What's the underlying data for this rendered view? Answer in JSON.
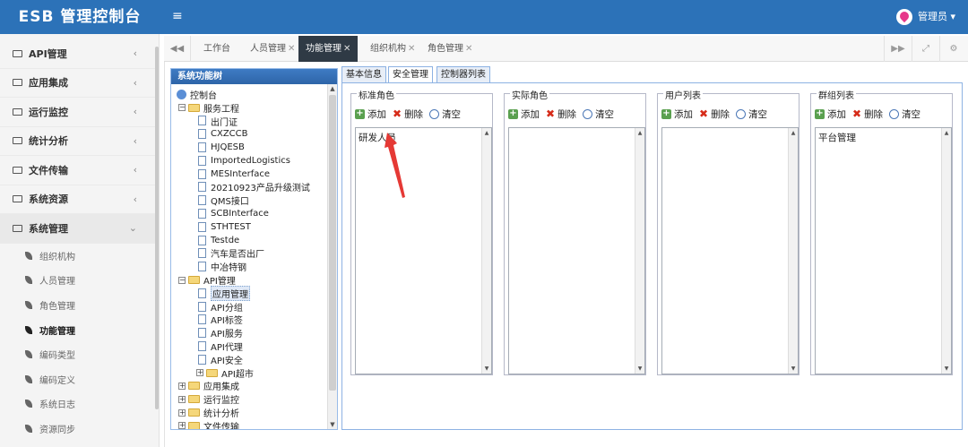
{
  "app": {
    "title": "ESB 管理控制台",
    "user": "管理员 ▾"
  },
  "sidebar": {
    "items": [
      {
        "label": "API管理"
      },
      {
        "label": "应用集成"
      },
      {
        "label": "运行监控"
      },
      {
        "label": "统计分析"
      },
      {
        "label": "文件传输"
      },
      {
        "label": "系统资源"
      },
      {
        "label": "系统管理"
      }
    ],
    "chev_closed": "‹",
    "chev_open": "⌄",
    "sub_items": [
      {
        "label": "组织机构"
      },
      {
        "label": "人员管理"
      },
      {
        "label": "角色管理"
      },
      {
        "label": "功能管理"
      },
      {
        "label": "编码类型"
      },
      {
        "label": "编码定义"
      },
      {
        "label": "系统日志"
      },
      {
        "label": "资源同步"
      }
    ]
  },
  "tabs": {
    "items": [
      {
        "label": "工作台"
      },
      {
        "label": "人员管理"
      },
      {
        "label": "功能管理"
      },
      {
        "label": "组织机构"
      },
      {
        "label": "角色管理"
      }
    ],
    "close": "✕"
  },
  "tree": {
    "title": "系统功能树",
    "root": "控制台",
    "rows": [
      {
        "label": "服务工程"
      },
      {
        "label": "出门证"
      },
      {
        "label": "CXZCCB"
      },
      {
        "label": "HJQESB"
      },
      {
        "label": "ImportedLogistics"
      },
      {
        "label": "MESInterface"
      },
      {
        "label": "20210923产品升级测试"
      },
      {
        "label": "QMS接口"
      },
      {
        "label": "SCBInterface"
      },
      {
        "label": "STHTEST"
      },
      {
        "label": "Testde"
      },
      {
        "label": "汽车是否出厂"
      },
      {
        "label": "中冶特钢"
      },
      {
        "label": "API管理"
      },
      {
        "label": "应用管理"
      },
      {
        "label": "API分组"
      },
      {
        "label": "API标签"
      },
      {
        "label": "API服务"
      },
      {
        "label": "API代理"
      },
      {
        "label": "API安全"
      },
      {
        "label": "API超市"
      },
      {
        "label": "应用集成"
      },
      {
        "label": "运行监控"
      },
      {
        "label": "统计分析"
      },
      {
        "label": "文件传输"
      }
    ]
  },
  "form_tabs": [
    {
      "label": "基本信息"
    },
    {
      "label": "安全管理"
    },
    {
      "label": "控制器列表"
    }
  ],
  "toolbar": {
    "add": "添加",
    "delete": "删除",
    "clear": "清空"
  },
  "fieldsets": [
    {
      "legend": "标准角色",
      "value": "研发人员"
    },
    {
      "legend": "实际角色",
      "value": ""
    },
    {
      "legend": "用户列表",
      "value": ""
    },
    {
      "legend": "群组列表",
      "value": "平台管理"
    }
  ],
  "colors": {
    "header": "#2c72b8",
    "active_tab": "#2f3a45",
    "annotation_arrow": "#e53935"
  }
}
